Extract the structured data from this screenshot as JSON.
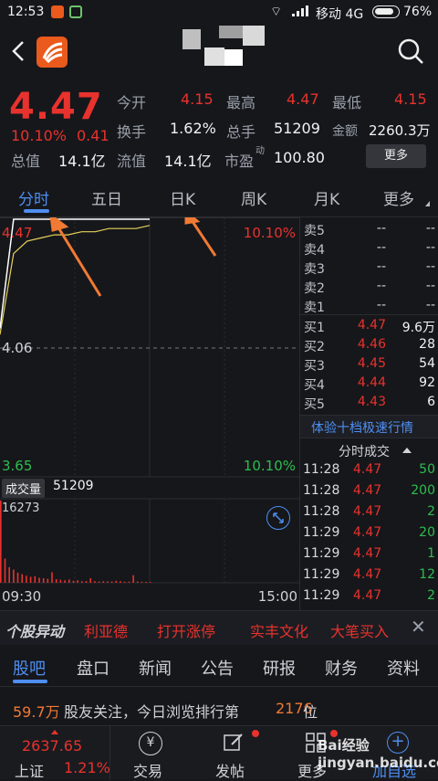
{
  "status": {
    "time": "12:53",
    "carrier": "移动 4G",
    "battery": "76%"
  },
  "quote": {
    "price": "4.47",
    "change_pct": "10.10%",
    "change": "0.41",
    "open_label": "今开",
    "open": "4.15",
    "high_label": "最高",
    "high": "4.47",
    "low_label": "最低",
    "low": "4.15",
    "turnover_label": "换手",
    "turnover": "1.62%",
    "volume_label": "总手",
    "volume": "51209",
    "amount_label": "金额",
    "amount": "2260.3万",
    "mktcap_label": "总值",
    "mktcap": "14.1亿",
    "float_label": "流值",
    "float": "14.1亿",
    "pe_label": "市盈",
    "pe_sup": "动",
    "pe": "100.80",
    "more": "更多"
  },
  "tabs": [
    "分时",
    "五日",
    "日K",
    "周K",
    "月K",
    "更多"
  ],
  "chart": {
    "high_price": "4.47",
    "high_pct": "10.10%",
    "mid_price": "4.06",
    "low_price": "3.65",
    "low_pct": "10.10%",
    "volume_label": "成交量",
    "volume": "51209",
    "volume_max": "16273",
    "time_start": "09:30",
    "time_end": "15:00"
  },
  "chart_data": {
    "type": "line",
    "series": [
      {
        "values": [
          4.1,
          4.36,
          4.4,
          4.41,
          4.42,
          4.42,
          4.43,
          4.43,
          4.44,
          4.44,
          4.44,
          4.45
        ]
      },
      {
        "values": [
          4.12,
          4.47,
          4.47,
          4.47,
          4.47,
          4.47,
          4.47,
          4.47,
          4.47,
          4.47,
          4.47,
          4.47
        ]
      }
    ],
    "ylim": [
      3.65,
      4.47
    ],
    "volumes": [
      16273,
      4800,
      3100,
      2600,
      2000,
      1700,
      1400,
      1200,
      1300,
      1000,
      900,
      800,
      2100,
      700,
      600,
      500,
      650,
      400,
      500,
      300,
      350,
      900,
      300,
      250,
      300,
      280,
      250,
      400,
      300,
      200,
      220,
      1500,
      250,
      200,
      180,
      150
    ]
  },
  "book": {
    "sells": [
      {
        "n": "卖5",
        "p": "--",
        "v": "--"
      },
      {
        "n": "卖4",
        "p": "--",
        "v": "--"
      },
      {
        "n": "卖3",
        "p": "--",
        "v": "--"
      },
      {
        "n": "卖2",
        "p": "--",
        "v": "--"
      },
      {
        "n": "卖1",
        "p": "--",
        "v": "--"
      }
    ],
    "buys": [
      {
        "n": "买1",
        "p": "4.47",
        "v": "9.6万"
      },
      {
        "n": "买2",
        "p": "4.46",
        "v": "28"
      },
      {
        "n": "买3",
        "p": "4.45",
        "v": "54"
      },
      {
        "n": "买4",
        "p": "4.44",
        "v": "92"
      },
      {
        "n": "买5",
        "p": "4.43",
        "v": "6"
      }
    ],
    "promo": "体验十档极速行情",
    "ticks_title": "分时成交",
    "ticks": [
      {
        "t": "11:28",
        "p": "4.47",
        "v": "50"
      },
      {
        "t": "11:28",
        "p": "4.47",
        "v": "200"
      },
      {
        "t": "11:28",
        "p": "4.47",
        "v": "2"
      },
      {
        "t": "11:29",
        "p": "4.47",
        "v": "20"
      },
      {
        "t": "11:29",
        "p": "4.47",
        "v": "1"
      },
      {
        "t": "11:29",
        "p": "4.47",
        "v": "12"
      },
      {
        "t": "11:29",
        "p": "4.47",
        "v": "2"
      }
    ]
  },
  "alert": {
    "label": "个股异动",
    "items": [
      "利亚德",
      "打开涨停",
      "实丰文化",
      "大笔买入"
    ]
  },
  "sections": [
    "股吧",
    "盘口",
    "新闻",
    "公告",
    "研报",
    "财务",
    "资料"
  ],
  "info": {
    "count": "59.7万",
    "text1": "股友关注，今日浏览排行第",
    "rank": "2176",
    "text2": "位"
  },
  "footer": {
    "index": "2637.65",
    "index_name": "上证",
    "index_pct": "1.21%",
    "trade": "交易",
    "post": "发帖",
    "more": "更多",
    "add": "加自选",
    "watermark": "Bai经验 jingyan.baidu.com"
  },
  "colors": {
    "up": "#e8322d",
    "down": "#2dbd4e",
    "accent": "#4e8ef1"
  }
}
